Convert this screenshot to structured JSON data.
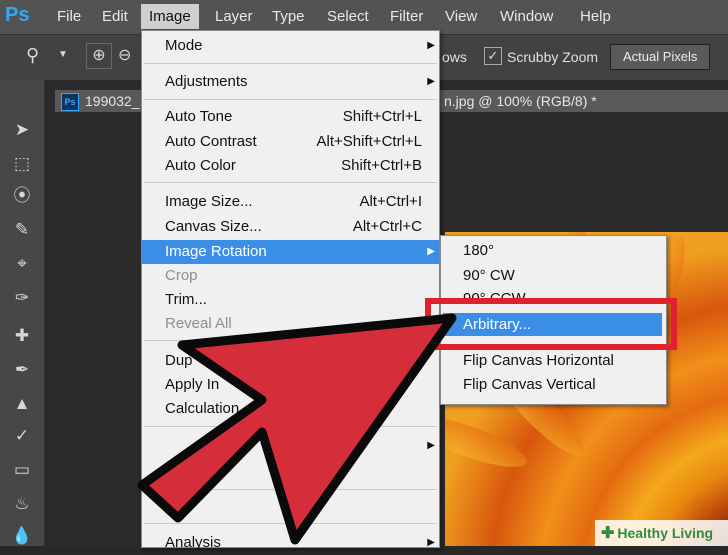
{
  "menubar": {
    "logo": "Ps",
    "items": [
      "File",
      "Edit",
      "Image",
      "Layer",
      "Type",
      "Select",
      "Filter",
      "View",
      "Window",
      "Help"
    ],
    "active": "Image"
  },
  "options_bar": {
    "partial_label": "ows",
    "scrubby_zoom_label": "Scrubby Zoom",
    "actual_pixels_label": "Actual Pixels"
  },
  "document": {
    "tab_left": "199032_1",
    "tab_right": "n.jpg @ 100% (RGB/8) *",
    "badge": "Ps"
  },
  "image_menu": {
    "items": [
      {
        "label": "Mode",
        "shortcut": "",
        "submenu": true
      },
      {
        "label": "Adjustments",
        "shortcut": "",
        "submenu": true
      },
      {
        "label": "Auto Tone",
        "shortcut": "Shift+Ctrl+L"
      },
      {
        "label": "Auto Contrast",
        "shortcut": "Alt+Shift+Ctrl+L"
      },
      {
        "label": "Auto Color",
        "shortcut": "Shift+Ctrl+B"
      },
      {
        "label": "Image Size...",
        "shortcut": "Alt+Ctrl+I"
      },
      {
        "label": "Canvas Size...",
        "shortcut": "Alt+Ctrl+C"
      },
      {
        "label": "Image Rotation",
        "shortcut": "",
        "submenu": true,
        "highlighted": true
      },
      {
        "label": "Crop",
        "shortcut": "",
        "disabled": true
      },
      {
        "label": "Trim...",
        "shortcut": ""
      },
      {
        "label": "Reveal All",
        "shortcut": "",
        "disabled": true
      },
      {
        "label": "Dup",
        "shortcut": ""
      },
      {
        "label": "Apply In",
        "shortcut": ""
      },
      {
        "label": "Calculation",
        "shortcut": ""
      },
      {
        "label": "Analysis",
        "shortcut": ""
      }
    ]
  },
  "rotation_submenu": {
    "items": [
      {
        "label": "180°"
      },
      {
        "label": "90° CW"
      },
      {
        "label": "90° CCW"
      },
      {
        "label": "Arbitrary...",
        "highlighted": true
      },
      {
        "label": "Flip Canvas Horizontal"
      },
      {
        "label": "Flip Canvas Vertical"
      }
    ]
  },
  "watermark": {
    "text": "Healthy Living"
  },
  "colors": {
    "highlight": "#3a8ee6",
    "callout_red": "#e0212e",
    "arrow_red": "#d62d3a",
    "menubar_bg": "#535353"
  },
  "icons": [
    "zoom-icon",
    "zoom-in-icon",
    "zoom-out-icon",
    "move-tool-icon",
    "marquee-tool-icon",
    "lasso-tool-icon",
    "quick-select-tool-icon",
    "crop-tool-icon",
    "eyedropper-tool-icon",
    "healing-tool-icon",
    "brush-tool-icon",
    "stamp-tool-icon",
    "history-brush-tool-icon",
    "eraser-tool-icon",
    "paint-bucket-tool-icon",
    "blur-tool-icon",
    "submenu-arrow-icon",
    "callout-arrow-icon"
  ]
}
